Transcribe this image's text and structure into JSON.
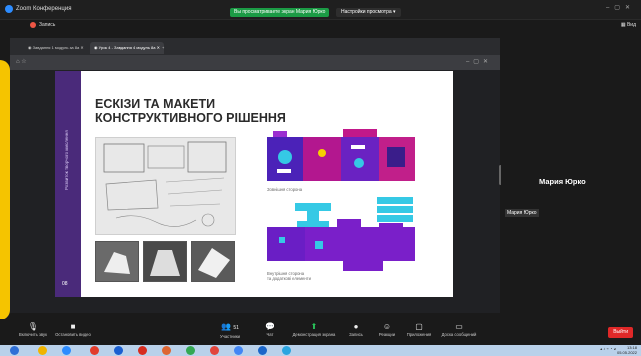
{
  "app": {
    "title": "Zoom Конференция"
  },
  "share_bar": {
    "status": "Вы просматриваете экран Мария Юрко",
    "view_options": "Настройки просмотра"
  },
  "recording": {
    "label": "Запись"
  },
  "view": {
    "label": "Вид"
  },
  "browser": {
    "tabs": [
      "Завдання 1 модуль за 8а",
      "Урок 4 - Завдання 4 модуль 8а"
    ]
  },
  "slide": {
    "title_line1": "ЕСКІЗИ ТА МАКЕТИ",
    "title_line2": "КОНСТРУКТИВНОГО РІШЕННЯ",
    "vertical_text": "Розвиток творчого мислення",
    "page_number": "08",
    "caption_top": "Зовнішня сторона",
    "caption_bottom_1": "Внутрішня сторона",
    "caption_bottom_2": "та додаткові елементи"
  },
  "participant": {
    "name_large": "Мария Юрко",
    "name_small": "Мария Юрко"
  },
  "toolbar": {
    "mute": "Включить звук",
    "video": "Остановить видео",
    "participants": "Участники",
    "participants_count": "51",
    "chat": "Чат",
    "share": "Демонстрация экрана",
    "record": "Запись",
    "reactions": "Реакции",
    "apps": "Приложения",
    "whiteboard": "Доска сообщений",
    "leave": "Выйти"
  },
  "taskbar": {
    "time": "13:18",
    "date": "05.05.2022"
  },
  "colors": {
    "accent_purple": "#4a2a7a",
    "zoom_blue": "#2d8cff",
    "leave_red": "#e02828",
    "share_green": "#1b9b45"
  }
}
